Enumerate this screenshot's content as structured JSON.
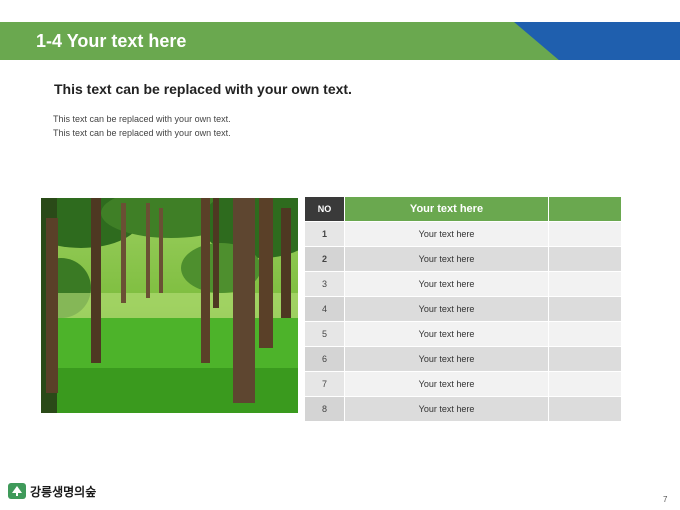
{
  "slide": {
    "title": "1-4 Your text here",
    "heading": "This text can be replaced with your own text.",
    "body_lines": [
      "This text can be replaced with your own text.",
      "This text can be replaced with your own text."
    ],
    "page_number": "7"
  },
  "table": {
    "header_no": "NO",
    "header_text": "Your text here",
    "header_extra": "",
    "rows": [
      {
        "no": "1",
        "text": "Your text here",
        "extra": ""
      },
      {
        "no": "2",
        "text": "Your text here",
        "extra": ""
      },
      {
        "no": "3",
        "text": "Your text here",
        "extra": ""
      },
      {
        "no": "4",
        "text": "Your text here",
        "extra": ""
      },
      {
        "no": "5",
        "text": "Your text here",
        "extra": ""
      },
      {
        "no": "6",
        "text": "Your text here",
        "extra": ""
      },
      {
        "no": "7",
        "text": "Your text here",
        "extra": ""
      },
      {
        "no": "8",
        "text": "Your text here",
        "extra": ""
      }
    ]
  },
  "image": {
    "icon": "forest-photo",
    "colors": {
      "grass": "#4db32a",
      "light": "#b8e07a",
      "trunk": "#5a4028",
      "canopy": "#2e6b1e"
    }
  },
  "logo": {
    "icon": "tree-logo-icon",
    "text": "강릉생명의숲"
  },
  "colors": {
    "accent_green": "#6aa84f",
    "accent_blue": "#1f5fae",
    "header_dark": "#3a3a3a"
  }
}
